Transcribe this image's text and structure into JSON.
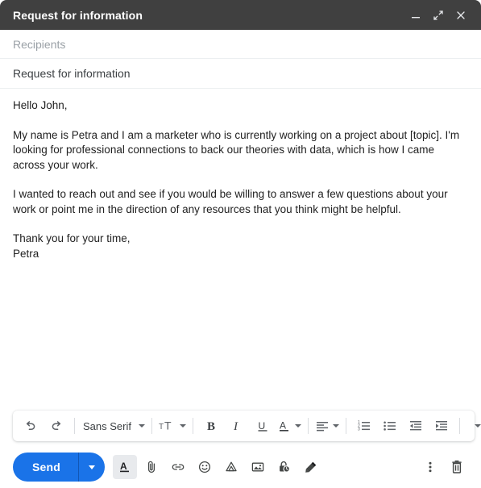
{
  "window": {
    "title": "Request for information",
    "controls": [
      {
        "name": "minimize-icon",
        "label": "Minimize"
      },
      {
        "name": "expand-icon",
        "label": "Full screen"
      },
      {
        "name": "close-icon",
        "label": "Save & close"
      }
    ]
  },
  "fields": {
    "recipients_placeholder": "Recipients",
    "subject_value": "Request for information"
  },
  "body": {
    "greeting": "Hello John,",
    "paragraph1": "My name is Petra and I am a marketer who is currently working on a project about [topic]. I'm looking for professional connections to back our theories with data, which is how I came across your work.",
    "paragraph2": "I wanted to reach out and see if you would be willing to answer a few questions about your work or point me in the direction of any resources that you think might be helpful.",
    "closing": "Thank you for your time,",
    "signature": "Petra"
  },
  "format_toolbar": {
    "undo_label": "Undo",
    "redo_label": "Redo",
    "font_name": "Sans Serif",
    "size_label": "Size",
    "bold_label": "Bold",
    "italic_label": "Italic",
    "underline_label": "Underline",
    "text_color_label": "Text color",
    "align_label": "Align",
    "numbered_list_label": "Numbered list",
    "bulleted_list_label": "Bulleted list",
    "indent_less_label": "Indent less",
    "indent_more_label": "Indent more",
    "more_format_label": "More formatting options"
  },
  "action_bar": {
    "send_label": "Send",
    "send_options_label": "More send options",
    "formatting_label": "Formatting options",
    "attach_label": "Attach files",
    "link_label": "Insert link",
    "emoji_label": "Insert emoji",
    "drive_label": "Insert files using Drive",
    "photo_label": "Insert photo",
    "confidential_label": "Toggle confidential mode",
    "signature_label": "Insert signature",
    "more_options_label": "More options",
    "discard_label": "Discard draft"
  },
  "colors": {
    "title_bar": "#404040",
    "send_blue": "#1a73e8",
    "icon_grey": "#5f6368",
    "placeholder_grey": "#9aa0a6"
  }
}
